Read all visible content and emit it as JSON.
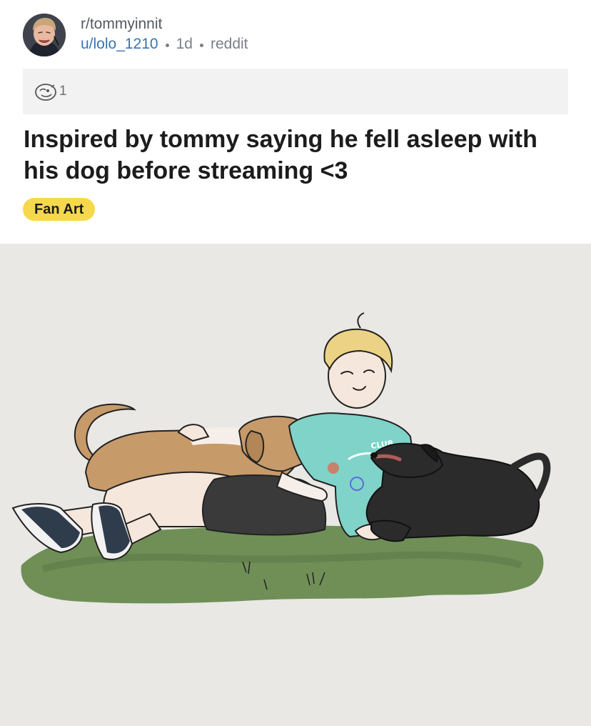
{
  "post": {
    "subreddit": "r/tommyinnit",
    "username": "u/lolo_1210",
    "age": "1d",
    "source": "reddit",
    "award_count": "1",
    "title": "Inspired by tommy saying he fell asleep with his dog before streaming <3",
    "flair": "Fan Art",
    "artwork_text": "CLUB"
  },
  "colors": {
    "username": "#3475b5",
    "flair_bg": "#f6d84c",
    "awards_bg": "#f2f2f2",
    "image_bg": "#e9e8e4"
  },
  "icons": {
    "award": "emoji-face-award-icon"
  }
}
